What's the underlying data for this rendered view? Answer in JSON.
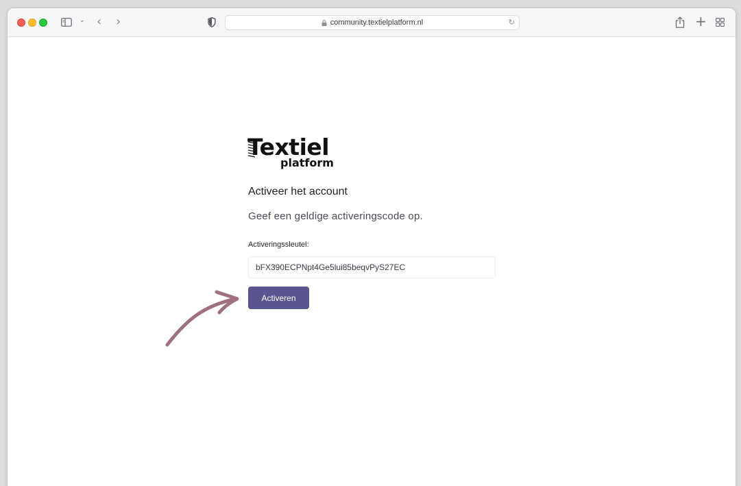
{
  "browser": {
    "url": "community.textielplatform.nl",
    "icons": {
      "sidebar": "sidebar-icon",
      "chevron": "chevron-down-icon",
      "back": "chevron-left-icon",
      "forward": "chevron-right-icon",
      "privacy": "shield-icon",
      "lock": "lock-icon",
      "reload": "reload-icon",
      "share": "share-icon",
      "new_tab": "plus-icon",
      "tab_overview": "grid-icon"
    },
    "glyphs": {
      "chevron": "⌄",
      "back": "‹",
      "forward": "›",
      "reload": "↻",
      "plus": "+"
    }
  },
  "logo": {
    "main": "Textiel",
    "sub": "platform"
  },
  "page": {
    "heading": "Activeer het account",
    "subtext": "Geef een geldige activeringscode op.",
    "field_label": "Activeringssleutel:",
    "code_value": "bFX390ECPNpt4Ge5lui85beqvPyS27EC",
    "button_label": "Activeren"
  },
  "colors": {
    "button": "#58558f",
    "arrow": "#a0707c"
  }
}
